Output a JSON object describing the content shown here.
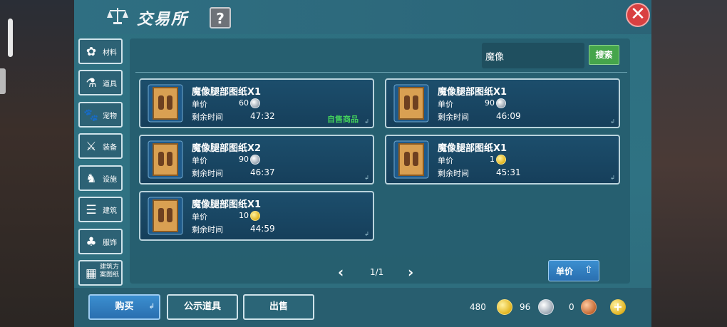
{
  "header": {
    "title": "交易所",
    "help_label": "?",
    "close_label": "✕"
  },
  "categories": [
    {
      "label": "材料",
      "icon": "materials-icon",
      "glyph": "✿"
    },
    {
      "label": "道具",
      "icon": "potion-icon",
      "glyph": "⚗"
    },
    {
      "label": "宠物",
      "icon": "paw-icon",
      "glyph": "🐾"
    },
    {
      "label": "装备",
      "icon": "sword-icon",
      "glyph": "⚔"
    },
    {
      "label": "设施",
      "icon": "facility-icon",
      "glyph": "♞"
    },
    {
      "label": "建筑",
      "icon": "building-icon",
      "glyph": "☰"
    },
    {
      "label": "服饰",
      "icon": "clothing-icon",
      "glyph": "♣"
    },
    {
      "label": "建筑方案图纸",
      "icon": "blueprint-icon",
      "glyph": "▦"
    }
  ],
  "search": {
    "value": "魔像",
    "button_label": "搜索"
  },
  "listings": [
    {
      "name": "魔像腿部图纸X1",
      "price_label": "单价",
      "price": "60",
      "currency": "silver",
      "time_label": "剩余时间",
      "time": "47:32",
      "badge": "自售商品",
      "corner": "↲"
    },
    {
      "name": "魔像腿部图纸X1",
      "price_label": "单价",
      "price": "90",
      "currency": "silver",
      "time_label": "剩余时间",
      "time": "46:09",
      "badge": "",
      "corner": "↲"
    },
    {
      "name": "魔像腿部图纸X2",
      "price_label": "单价",
      "price": "90",
      "currency": "silver",
      "time_label": "剩余时间",
      "time": "46:37",
      "badge": "",
      "corner": "↲"
    },
    {
      "name": "魔像腿部图纸X1",
      "price_label": "单价",
      "price": "1",
      "currency": "gold",
      "time_label": "剩余时间",
      "time": "45:31",
      "badge": "",
      "corner": "↲"
    },
    {
      "name": "魔像腿部图纸X1",
      "price_label": "单价",
      "price": "10",
      "currency": "gold",
      "time_label": "剩余时间",
      "time": "44:59",
      "badge": "",
      "corner": "↲"
    }
  ],
  "pager": {
    "prev": "‹",
    "text": "1/1",
    "next": "›"
  },
  "sort": {
    "label": "单价",
    "icon": "sort-arrow-icon",
    "glyph": "⇧"
  },
  "actions": {
    "buy": "购买",
    "buy_icon": "↲",
    "showcase": "公示道具",
    "sell": "出售"
  },
  "currencies": [
    {
      "value": "480",
      "type": "gold"
    },
    {
      "value": "96",
      "type": "silver"
    },
    {
      "value": "0",
      "type": "copper"
    }
  ],
  "plus_label": "+",
  "colors": {
    "panel": "#2d6f80",
    "card": "#1c4e6c",
    "search_button": "#45a54b",
    "close": "#d94041",
    "badge": "#43d05c"
  }
}
